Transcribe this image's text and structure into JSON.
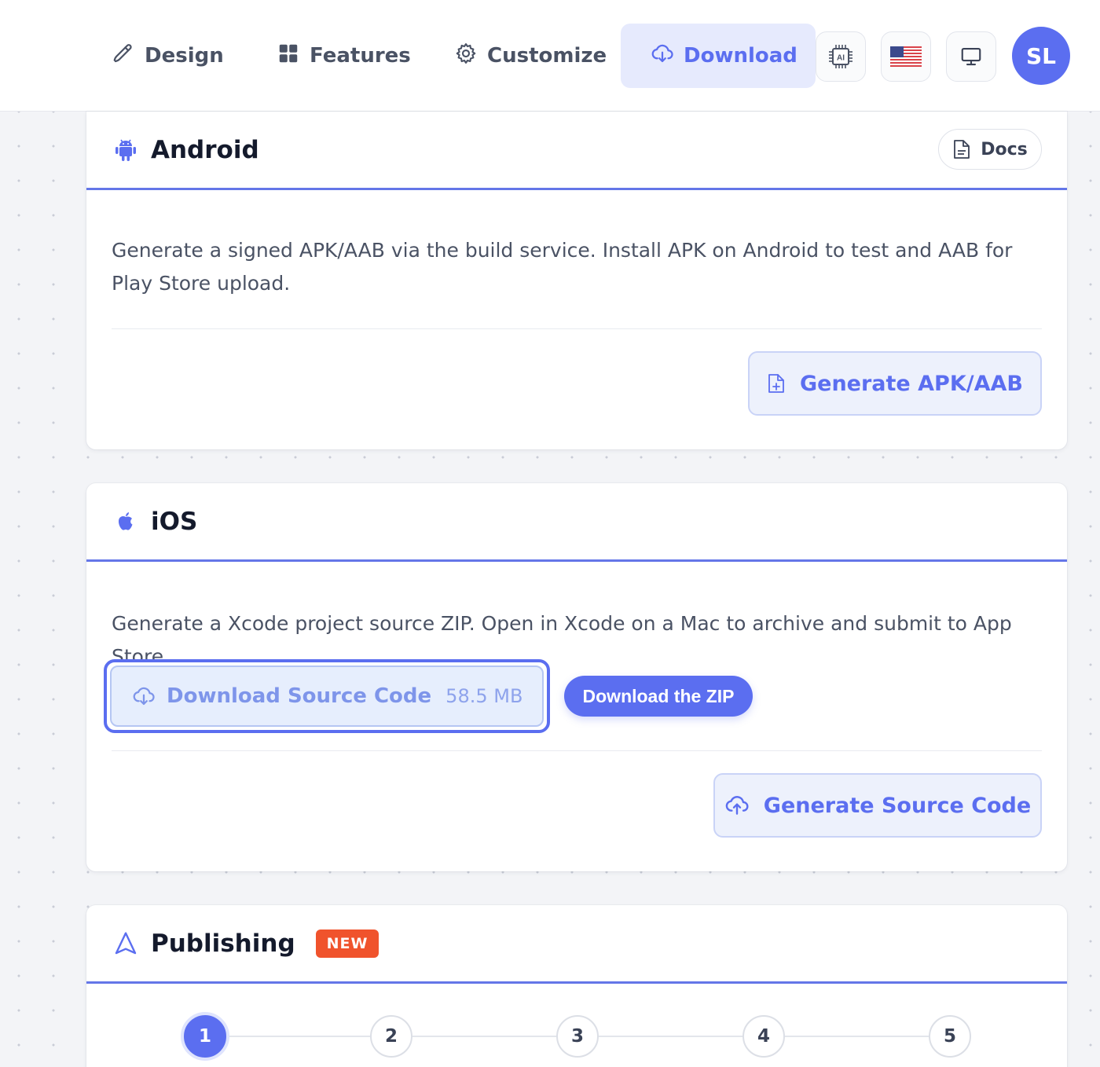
{
  "nav": {
    "tabs": [
      {
        "label": "Design",
        "icon": "pen-icon"
      },
      {
        "label": "Features",
        "icon": "grid-icon"
      },
      {
        "label": "Customize",
        "icon": "gear-icon"
      },
      {
        "label": "Download",
        "icon": "cloud-download-icon",
        "active": true
      }
    ],
    "ai_label": "AI",
    "avatar_initials": "SL",
    "accent_color": "#5b6ef0"
  },
  "android": {
    "title": "Android",
    "docs_label": "Docs",
    "description": "Generate a signed APK/AAB via the build service. Install APK on Android to test and AAB for Play Store upload.",
    "generate_label": "Generate APK/AAB"
  },
  "ios": {
    "title": "iOS",
    "description": "Generate a Xcode project source ZIP. Open in Xcode on a Mac to archive and submit to App Store.",
    "download_source_label": "Download Source Code",
    "download_source_size": "58.5 MB",
    "zip_label": "Download the ZIP",
    "generate_label": "Generate Source Code"
  },
  "publishing": {
    "title": "Publishing",
    "badge": "NEW",
    "badge_color": "#f0532c",
    "steps": [
      "1",
      "2",
      "3",
      "4",
      "5"
    ],
    "active_step": 1
  }
}
